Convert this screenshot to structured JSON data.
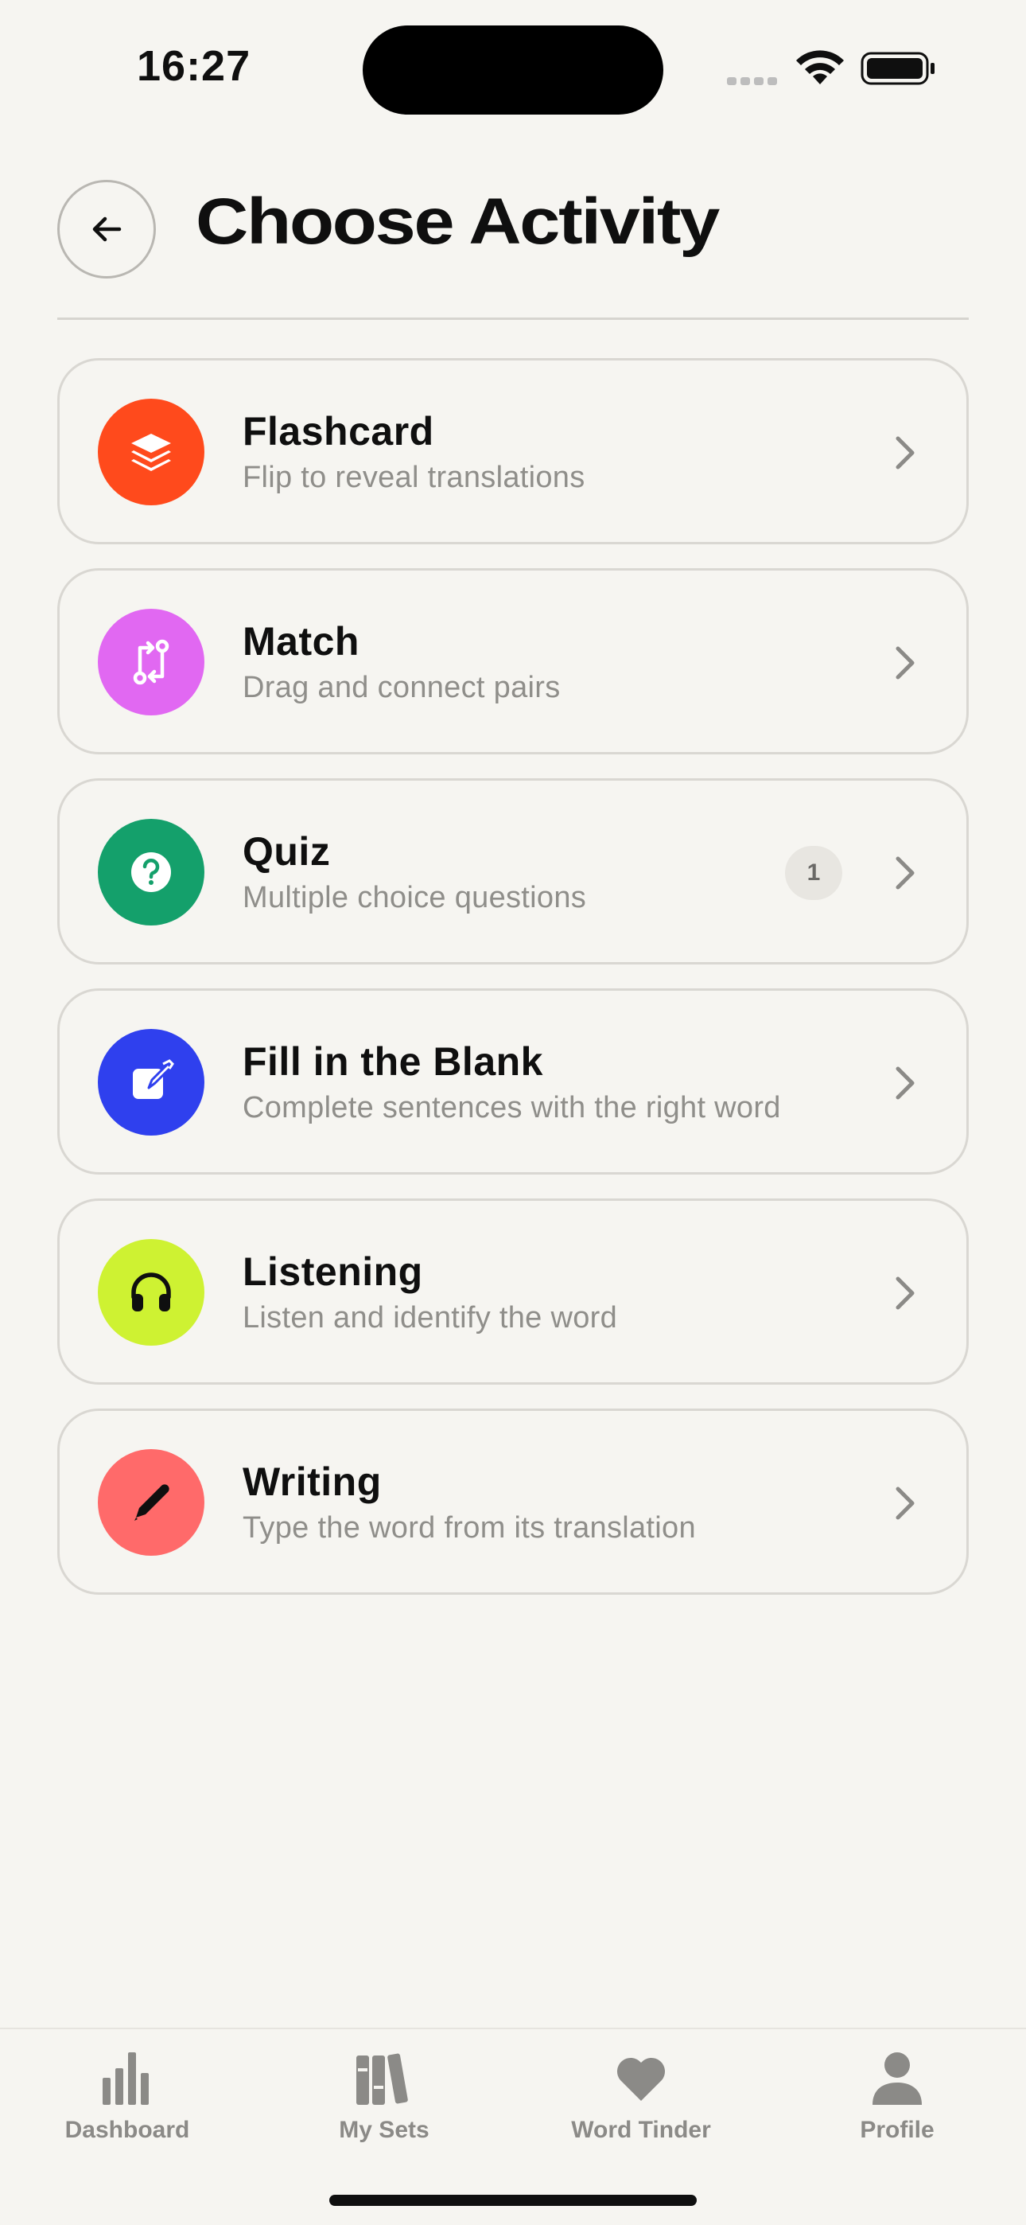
{
  "status_bar": {
    "time": "16:27"
  },
  "header": {
    "title": "Choose Activity"
  },
  "activities": [
    {
      "title": "Flashcard",
      "subtitle": "Flip to reveal translations",
      "icon": "stack-icon",
      "color": "#ff4a1c"
    },
    {
      "title": "Match",
      "subtitle": "Drag and connect pairs",
      "icon": "connect-arrows-icon",
      "color": "#e168f2"
    },
    {
      "title": "Quiz",
      "subtitle": "Multiple choice questions",
      "icon": "question-icon",
      "color": "#14a06b",
      "badge": "1"
    },
    {
      "title": "Fill in the Blank",
      "subtitle": "Complete sentences with the right word",
      "icon": "edit-square-icon",
      "color": "#2f40ee"
    },
    {
      "title": "Listening",
      "subtitle": "Listen and identify the word",
      "icon": "headphones-icon",
      "color": "#cef232"
    },
    {
      "title": "Writing",
      "subtitle": "Type the word from its translation",
      "icon": "pencil-icon",
      "color": "#ff6a6a"
    }
  ],
  "tab_bar": {
    "items": [
      {
        "label": "Dashboard",
        "icon": "bar-chart-icon"
      },
      {
        "label": "My Sets",
        "icon": "books-icon"
      },
      {
        "label": "Word Tinder",
        "icon": "heart-icon"
      },
      {
        "label": "Profile",
        "icon": "person-icon"
      }
    ]
  }
}
